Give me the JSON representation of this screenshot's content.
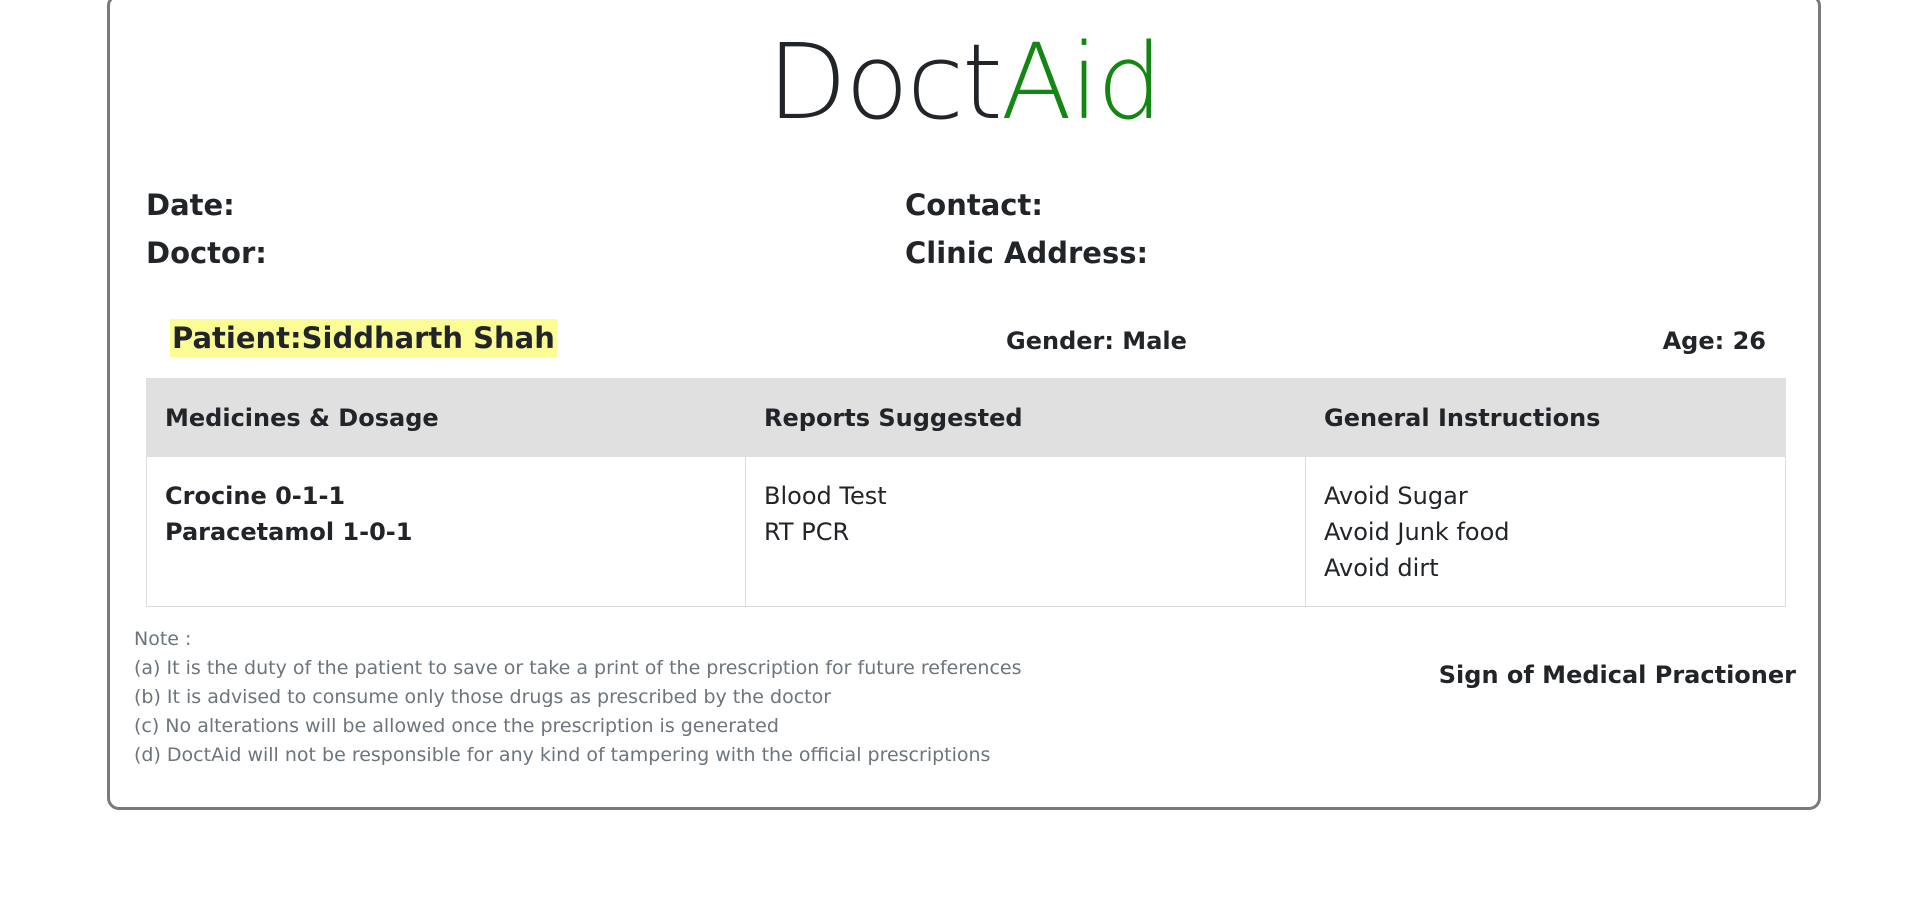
{
  "brand": {
    "part1": "Doct",
    "part2": "Aid",
    "part2_color": "#138613"
  },
  "info": {
    "date_label": "Date:",
    "doctor_label": "Doctor:",
    "contact_label": "Contact:",
    "clinic_label": "Clinic Address:"
  },
  "patient": {
    "name_text": "Patient:Siddharth Shah",
    "gender_text": "Gender: Male",
    "age_text": "Age: 26"
  },
  "table": {
    "headers": [
      "Medicines & Dosage",
      "Reports Suggested",
      "General Instructions"
    ],
    "medicines": [
      "Crocine 0-1-1",
      "Paracetamol 1-0-1"
    ],
    "reports": [
      "Blood Test",
      "RT PCR"
    ],
    "instructions": [
      "Avoid Sugar",
      "Avoid Junk food",
      "Avoid dirt"
    ]
  },
  "notes": {
    "title": "Note :",
    "items": [
      "(a) It is the duty of the patient to save or take a print of the prescription for future references",
      "(b) It is advised to consume only those drugs as prescribed by the doctor",
      "(c) No alterations will be allowed once the prescription is generated",
      "(d) DoctAid will not be responsible for any kind of tampering with the official prescriptions"
    ]
  },
  "sign": "Sign of Medical Practioner"
}
